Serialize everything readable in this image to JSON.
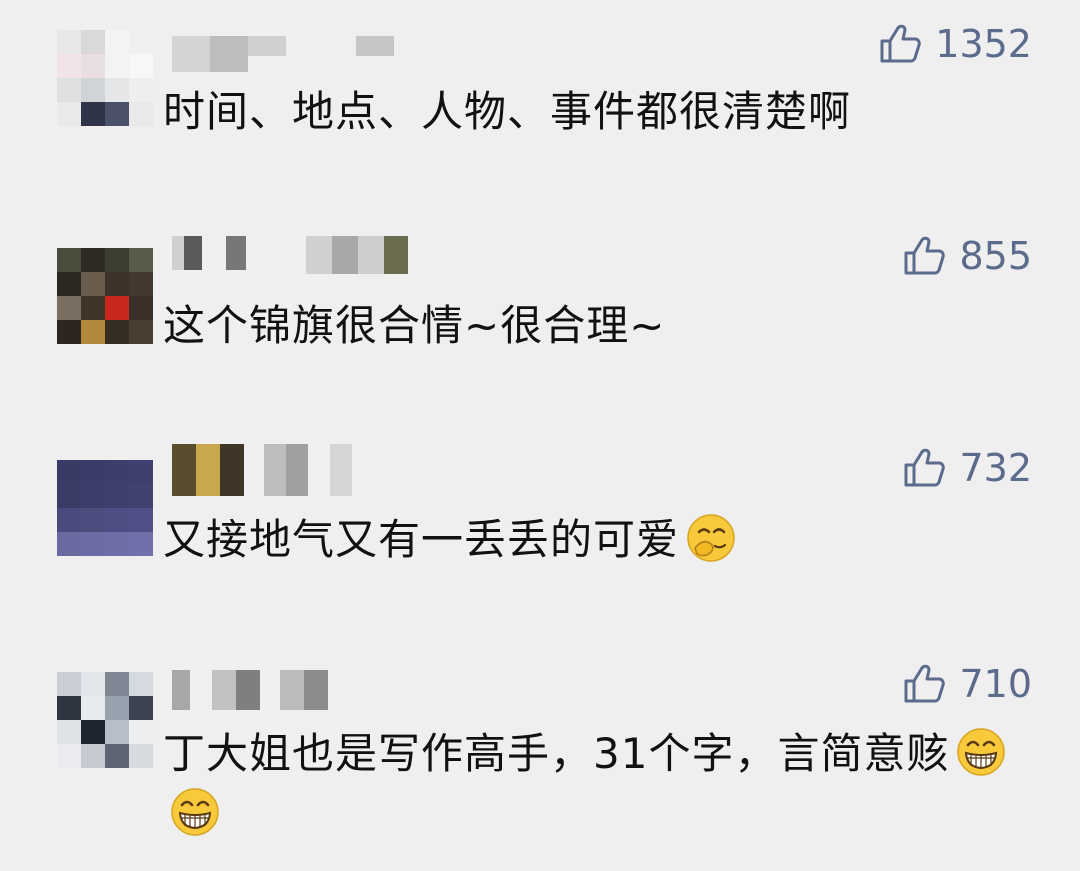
{
  "comments": [
    {
      "likes": "1352",
      "text": "时间、地点、人物、事件都很清楚啊",
      "emoji": []
    },
    {
      "likes": "855",
      "text": "这个锦旗很合情~很合理~",
      "emoji": []
    },
    {
      "likes": "732",
      "text": "又接地气又有一丢丢的可爱",
      "emoji": [
        "shy-giggle-emoji"
      ]
    },
    {
      "likes": "710",
      "text": "丁大姐也是写作高手，31个字，言简意赅",
      "emoji": [
        "grin-emoji",
        "grin-emoji"
      ]
    }
  ],
  "icons": {
    "like": "thumbs-up-icon"
  },
  "colors": {
    "background": "#efefef",
    "like": "#5b6b8c",
    "text": "#111111"
  }
}
